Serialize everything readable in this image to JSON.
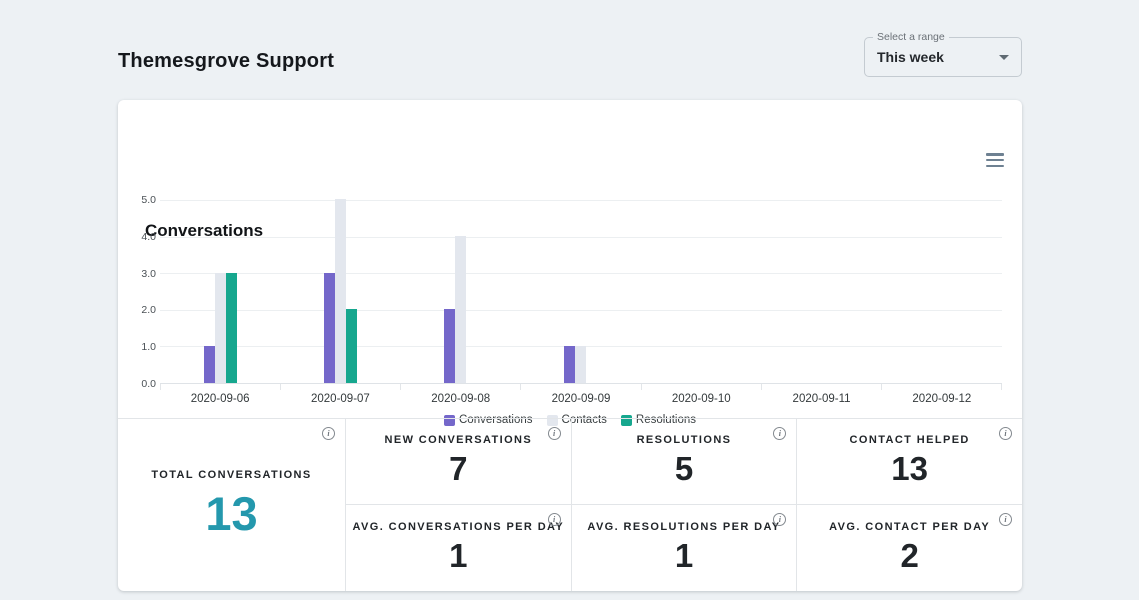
{
  "page": {
    "title": "Themesgrove Support",
    "bg_color": "#edf1f4"
  },
  "range_select": {
    "label": "Select a range",
    "value": "This week"
  },
  "chart_card": {
    "title": "Conversations",
    "menu_icon": "hamburger-icon"
  },
  "chart_data": {
    "type": "bar",
    "title": "Conversations",
    "categories": [
      "2020-09-06",
      "2020-09-07",
      "2020-09-08",
      "2020-09-09",
      "2020-09-10",
      "2020-09-11",
      "2020-09-12"
    ],
    "series": [
      {
        "name": "Conversations",
        "color": "#7467ca",
        "values": [
          1,
          3,
          2,
          1,
          0,
          0,
          0
        ]
      },
      {
        "name": "Contacts",
        "color": "#e3e7ee",
        "values": [
          3,
          5,
          4,
          1,
          0,
          0,
          0
        ]
      },
      {
        "name": "Resolutions",
        "color": "#16a78e",
        "values": [
          3,
          2,
          0,
          0,
          0,
          0,
          0
        ]
      }
    ],
    "ylim": [
      0,
      5
    ],
    "yticks": [
      "5.0",
      "4.0",
      "3.0",
      "2.0",
      "1.0",
      "0.0"
    ],
    "grid": true,
    "legend_position": "bottom"
  },
  "stats": {
    "primary": {
      "label": "TOTAL CONVERSATIONS",
      "value": "13",
      "color": "#2498ad"
    },
    "cells": [
      {
        "label": "NEW CONVERSATIONS",
        "value": "7"
      },
      {
        "label": "RESOLUTIONS",
        "value": "5"
      },
      {
        "label": "CONTACT HELPED",
        "value": "13"
      },
      {
        "label": "AVG. CONVERSATIONS PER DAY",
        "value": "1"
      },
      {
        "label": "AVG. RESOLUTIONS PER DAY",
        "value": "1"
      },
      {
        "label": "AVG. CONTACT PER DAY",
        "value": "2"
      }
    ]
  }
}
